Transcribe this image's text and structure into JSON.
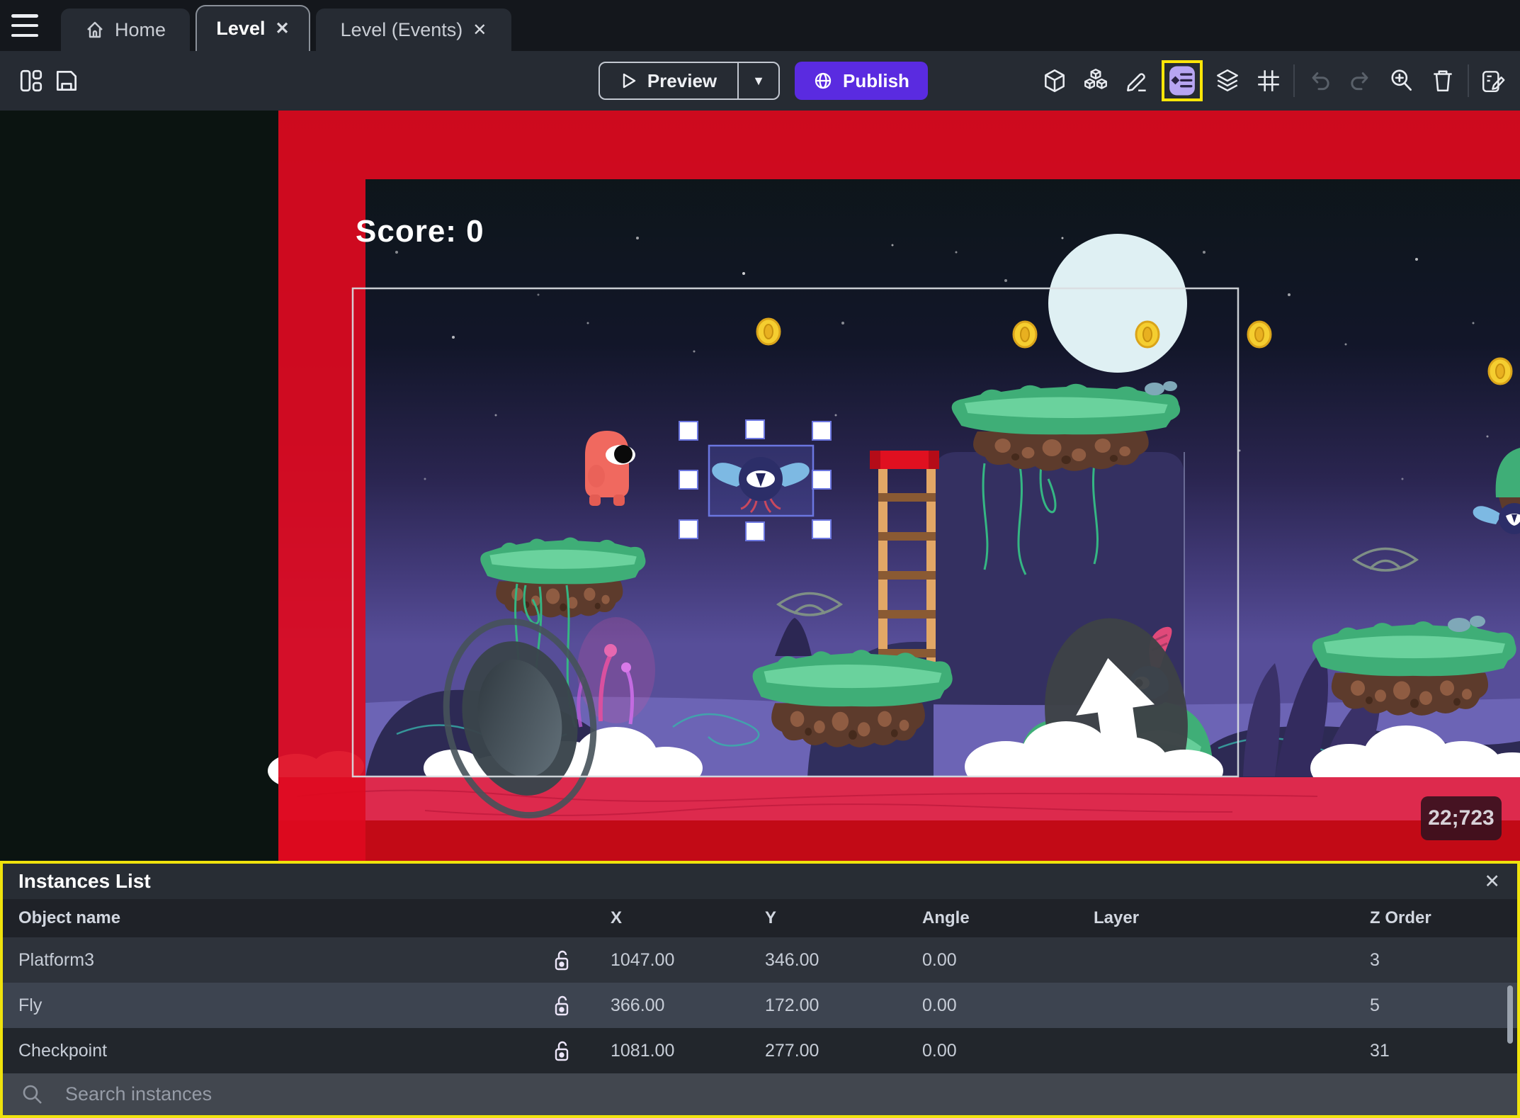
{
  "ui": {
    "close_glyph": "✕",
    "caret_glyph": "▼"
  },
  "tabs": [
    {
      "label": "Home",
      "active": false
    },
    {
      "label": "Level",
      "active": true
    },
    {
      "label": "Level (Events)",
      "active": false
    }
  ],
  "toolbar": {
    "preview_label": "Preview",
    "publish_label": "Publish",
    "left_icons": [
      "layout-panels-icon",
      "save-icon"
    ],
    "right_icons": [
      "object-cube-icon",
      "objects-group-icon",
      "edit-pencil-icon",
      "instances-list-icon (highlighted)",
      "layers-icon",
      "grid-icon",
      "undo-icon",
      "redo-icon",
      "zoom-in-icon",
      "trash-icon",
      "scene-edit-icon"
    ]
  },
  "canvas": {
    "score_text": "Score: 0",
    "coords_badge": "22;723",
    "selected_instance": "Fly"
  },
  "panel": {
    "title": "Instances List",
    "columns": [
      "Object name",
      "X",
      "Y",
      "Angle",
      "Layer",
      "Z Order"
    ],
    "rows": [
      {
        "name": "Platform3",
        "locked": false,
        "x": "1047.00",
        "y": "346.00",
        "angle": "0.00",
        "layer": "",
        "z_order": "3"
      },
      {
        "name": "Fly",
        "locked": false,
        "x": "366.00",
        "y": "172.00",
        "angle": "0.00",
        "layer": "",
        "z_order": "5"
      },
      {
        "name": "Checkpoint",
        "locked": false,
        "x": "1081.00",
        "y": "277.00",
        "angle": "0.00",
        "layer": "",
        "z_order": "31"
      }
    ],
    "search_placeholder": "Search instances"
  },
  "colors": {
    "accent_purple": "#5a2be0",
    "highlight_yellow": "#efe20c",
    "tool_highlight_bg": "#b7a5f2",
    "selection_blue": "#6b76e0",
    "red_zone": "#de0a1f",
    "ground_crimson": "#dd2a4d",
    "panel_bg": "#282d34"
  }
}
